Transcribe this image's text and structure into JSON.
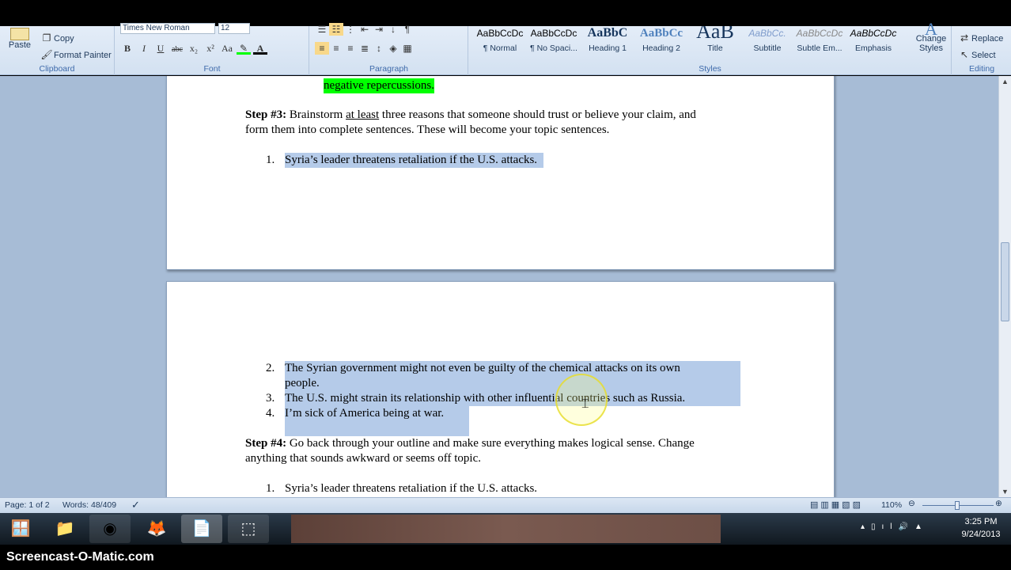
{
  "ribbon": {
    "clipboard": {
      "label": "Clipboard",
      "paste": "Paste",
      "copy": "Copy",
      "format_painter": "Format Painter"
    },
    "font": {
      "label": "Font",
      "font_name": "Times New Roman",
      "font_size": "12",
      "bold": "B",
      "italic": "I",
      "underline": "U",
      "strike": "abc",
      "subscript": "x₂",
      "superscript": "x²",
      "case": "Aa"
    },
    "paragraph": {
      "label": "Paragraph"
    },
    "styles": {
      "label": "Styles",
      "items": [
        {
          "preview": "AaBbCcDc",
          "name": "¶ Normal"
        },
        {
          "preview": "AaBbCcDc",
          "name": "¶ No Spaci..."
        },
        {
          "preview": "AaBbC",
          "name": "Heading 1"
        },
        {
          "preview": "AaBbCc",
          "name": "Heading 2"
        },
        {
          "preview": "AaB",
          "name": "Title"
        },
        {
          "preview": "AaBbCc.",
          "name": "Subtitle"
        },
        {
          "preview": "AaBbCcDc",
          "name": "Subtle Em..."
        },
        {
          "preview": "AaBbCcDc",
          "name": "Emphasis"
        }
      ],
      "change_styles": "Change Styles"
    },
    "editing": {
      "label": "Editing",
      "replace": "Replace",
      "select": "Select"
    }
  },
  "document": {
    "page1": {
      "highlighted": "negative repercussions.",
      "step3_label": "Step #3:",
      "step3_a": " Brainstorm ",
      "step3_b": "at least",
      "step3_c": " three reasons that someone should trust or believe your claim, and",
      "step3_line2": "form them into complete sentences.  These will become your topic sentences.",
      "list": [
        {
          "num": "1.",
          "text": "Syria’s leader threatens retaliation if the U.S. attacks."
        }
      ]
    },
    "page2": {
      "list": [
        {
          "num": "2.",
          "text": "The Syrian government might not even be guilty of the chemical attacks on its own",
          "cont": "people."
        },
        {
          "num": "3.",
          "text": "The U.S. might strain its relationship with other influential countries such as Russia."
        },
        {
          "num": "4.",
          "text": "I’m sick of America being at war."
        }
      ],
      "step4_label": "Step #4:",
      "step4_line1": " Go back through your outline and make sure everything makes logical sense.  Change",
      "step4_line2": "anything that sounds awkward or seems off topic.",
      "list2": [
        {
          "num": "1.",
          "text": "Syria’s leader threatens retaliation if the U.S. attacks."
        }
      ]
    }
  },
  "status": {
    "page": "Page: 1 of 2",
    "words": "Words: 48/409",
    "zoom": "110%"
  },
  "taskbar": {
    "time": "3:25 PM",
    "date": "9/24/2013"
  },
  "watermark": "Screencast-O-Matic.com",
  "colors": {
    "selection": "#b5cbe9",
    "highlight": "#00ff00"
  }
}
